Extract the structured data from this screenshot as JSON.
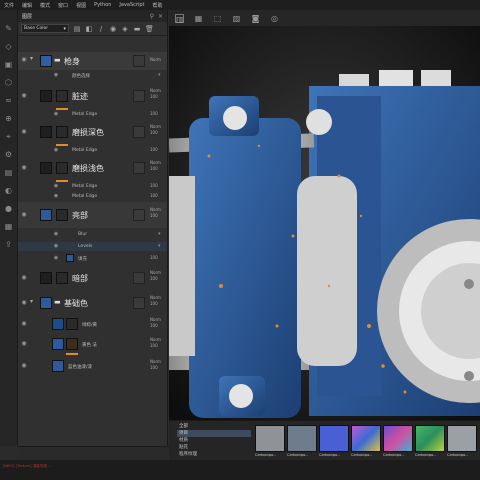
{
  "menu": [
    "文件",
    "编辑",
    "模式",
    "窗口",
    "视图",
    "Python",
    "JavaScript",
    "帮助"
  ],
  "layers_panel": {
    "title": "图层",
    "channel": "Base Color",
    "layers": [
      {
        "name": "枪身",
        "kind": "folder"
      },
      {
        "name": "颜色选择",
        "kind": "sub"
      },
      {
        "name": "脏迹",
        "blend": [
          "Norm",
          "100"
        ]
      },
      {
        "name": "Metal Edge",
        "kind": "sub"
      },
      {
        "name": "磨损深色",
        "blend": [
          "Norm",
          "100"
        ]
      },
      {
        "name": "Metal Edge",
        "kind": "sub"
      },
      {
        "name": "磨损浅色",
        "blend": [
          "Norm",
          "100"
        ]
      },
      {
        "name": "Metal Edge",
        "kind": "sub"
      },
      {
        "name": "Metal Edge",
        "kind": "sub"
      },
      {
        "name": "亮部",
        "blend": [
          "Norm",
          "100"
        ]
      },
      {
        "name": "Blur",
        "kind": "sub"
      },
      {
        "name": "Levels",
        "kind": "sub"
      },
      {
        "name": "填充",
        "kind": "sub"
      },
      {
        "name": "暗部",
        "blend": [
          "Norm",
          "100"
        ]
      },
      {
        "name": "基础色",
        "kind": "folder"
      },
      {
        "name": "绿棕/黄",
        "kind": "small"
      },
      {
        "name": "黄色 法",
        "kind": "small"
      },
      {
        "name": "蓝色油漆/漆",
        "kind": "small"
      }
    ]
  },
  "shelf": {
    "categories": [
      "全部",
      "项目",
      "材质",
      "贴花",
      "程序纹理"
    ],
    "selected": "项目",
    "materials": [
      {
        "name": "Cartoonpo...",
        "color": "#8f9397"
      },
      {
        "name": "Cartoonpo...",
        "color": "#6e7c8c"
      },
      {
        "name": "Cartoonpo...",
        "color": "#4a5fd4"
      },
      {
        "name": "Cartoonpo...",
        "color": "#c25ad0"
      },
      {
        "name": "Cartoonpo...",
        "color": "#6a4fcf"
      },
      {
        "name": "Cartoonpo...",
        "color": "#46b56a"
      },
      {
        "name": "Cartoonpo...",
        "color": "#9aa0a6"
      }
    ]
  },
  "log": "[INFO] [Texture] 渲染完成 ...",
  "colors": {
    "accent_orange": "#e08a2a",
    "panel_bg": "#303030",
    "blue_paint": "#2e5a9a"
  }
}
